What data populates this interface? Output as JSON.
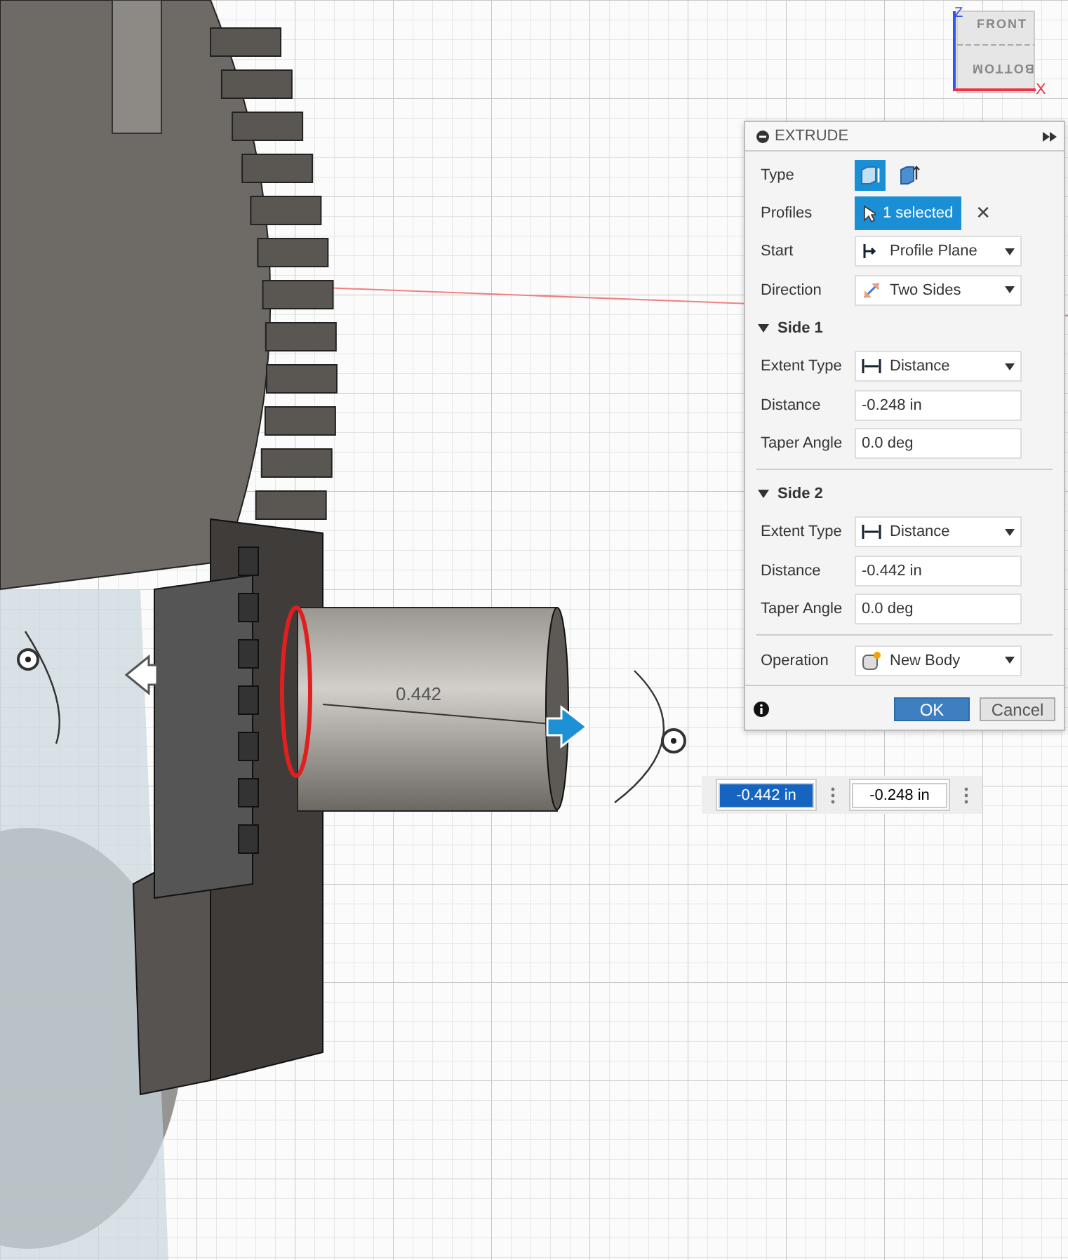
{
  "viewcube": {
    "top_face": "FRONT",
    "front_face": "BOTTOM",
    "x_axis": "X",
    "z_axis": "Z"
  },
  "dimension_label": "0.442",
  "dialog": {
    "title": "EXTRUDE",
    "rows": [
      {
        "kind": "icons",
        "label": "Type",
        "options": [
          {
            "selected": true
          },
          {
            "selected": false
          }
        ]
      },
      {
        "kind": "selection",
        "label": "Profiles",
        "value": "1 selected",
        "clear": "✕"
      },
      {
        "kind": "dropdown",
        "label": "Start",
        "value": "Profile Plane"
      },
      {
        "kind": "dropdown",
        "label": "Direction",
        "value": "Two Sides"
      },
      {
        "kind": "section",
        "label": "Side 1",
        "expanded": true
      },
      {
        "kind": "dropdown",
        "label": "Extent Type",
        "value": "Distance"
      },
      {
        "kind": "input",
        "label": "Distance",
        "value": "-0.248 in"
      },
      {
        "kind": "input",
        "label": "Taper Angle",
        "value": "0.0 deg"
      },
      {
        "kind": "divider"
      },
      {
        "kind": "section",
        "label": "Side 2",
        "expanded": true
      },
      {
        "kind": "dropdown",
        "label": "Extent Type",
        "value": "Distance"
      },
      {
        "kind": "input",
        "label": "Distance",
        "value": "-0.442 in"
      },
      {
        "kind": "input",
        "label": "Taper Angle",
        "value": "0.0 deg"
      },
      {
        "kind": "divider"
      },
      {
        "kind": "dropdown",
        "label": "Operation",
        "value": "New Body"
      }
    ],
    "buttons": [
      {
        "label": "OK",
        "kind": "primary"
      },
      {
        "label": "Cancel",
        "kind": "secondary"
      }
    ]
  },
  "inline_inputs": [
    {
      "value": "-0.442 in",
      "selected": true
    },
    {
      "value": "-0.248 in",
      "selected": false
    }
  ]
}
